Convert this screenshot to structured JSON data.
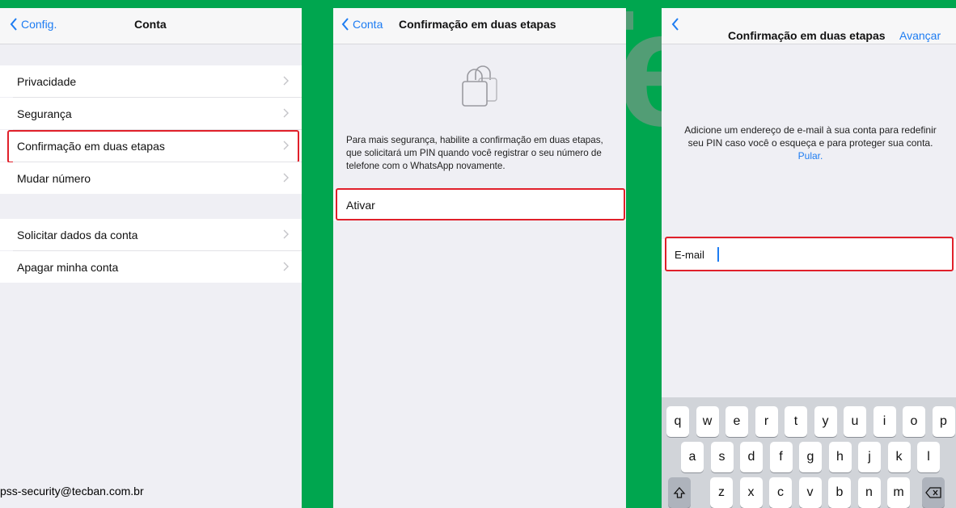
{
  "panel1": {
    "back_label": "Config.",
    "title": "Conta",
    "group1": [
      "Privacidade",
      "Segurança",
      "Confirmação em duas etapas",
      "Mudar número"
    ],
    "group2": [
      "Solicitar dados da conta",
      "Apagar minha conta"
    ]
  },
  "panel2": {
    "back_label": "Conta",
    "title": "Confirmação em duas etapas",
    "description": "Para mais segurança, habilite a confirmação em duas etapas, que solicitará um PIN quando você registrar o seu número de telefone com o WhatsApp novamente.",
    "activate_label": "Ativar"
  },
  "panel3": {
    "title": "Confirmação em duas etapas",
    "next_label": "Avançar",
    "description": "Adicione um endereço de e-mail à sua conta para redefinir seu PIN caso você o esqueça e para proteger sua conta.",
    "skip_label": "Pular.",
    "email_label": "E-mail",
    "email_value": "",
    "keyboard_row1": [
      "q",
      "w",
      "e",
      "r",
      "t",
      "y",
      "u",
      "i",
      "o",
      "p"
    ],
    "keyboard_row2": [
      "a",
      "s",
      "d",
      "f",
      "g",
      "h",
      "j",
      "k",
      "l"
    ],
    "keyboard_row3": [
      "z",
      "x",
      "c",
      "v",
      "b",
      "n",
      "m"
    ]
  },
  "watermark": "TecB",
  "footer_email": "pss-security@tecban.com.br",
  "colors": {
    "background": "#00a64f",
    "accent": "#1d7cf2",
    "highlight": "#e0202a"
  }
}
